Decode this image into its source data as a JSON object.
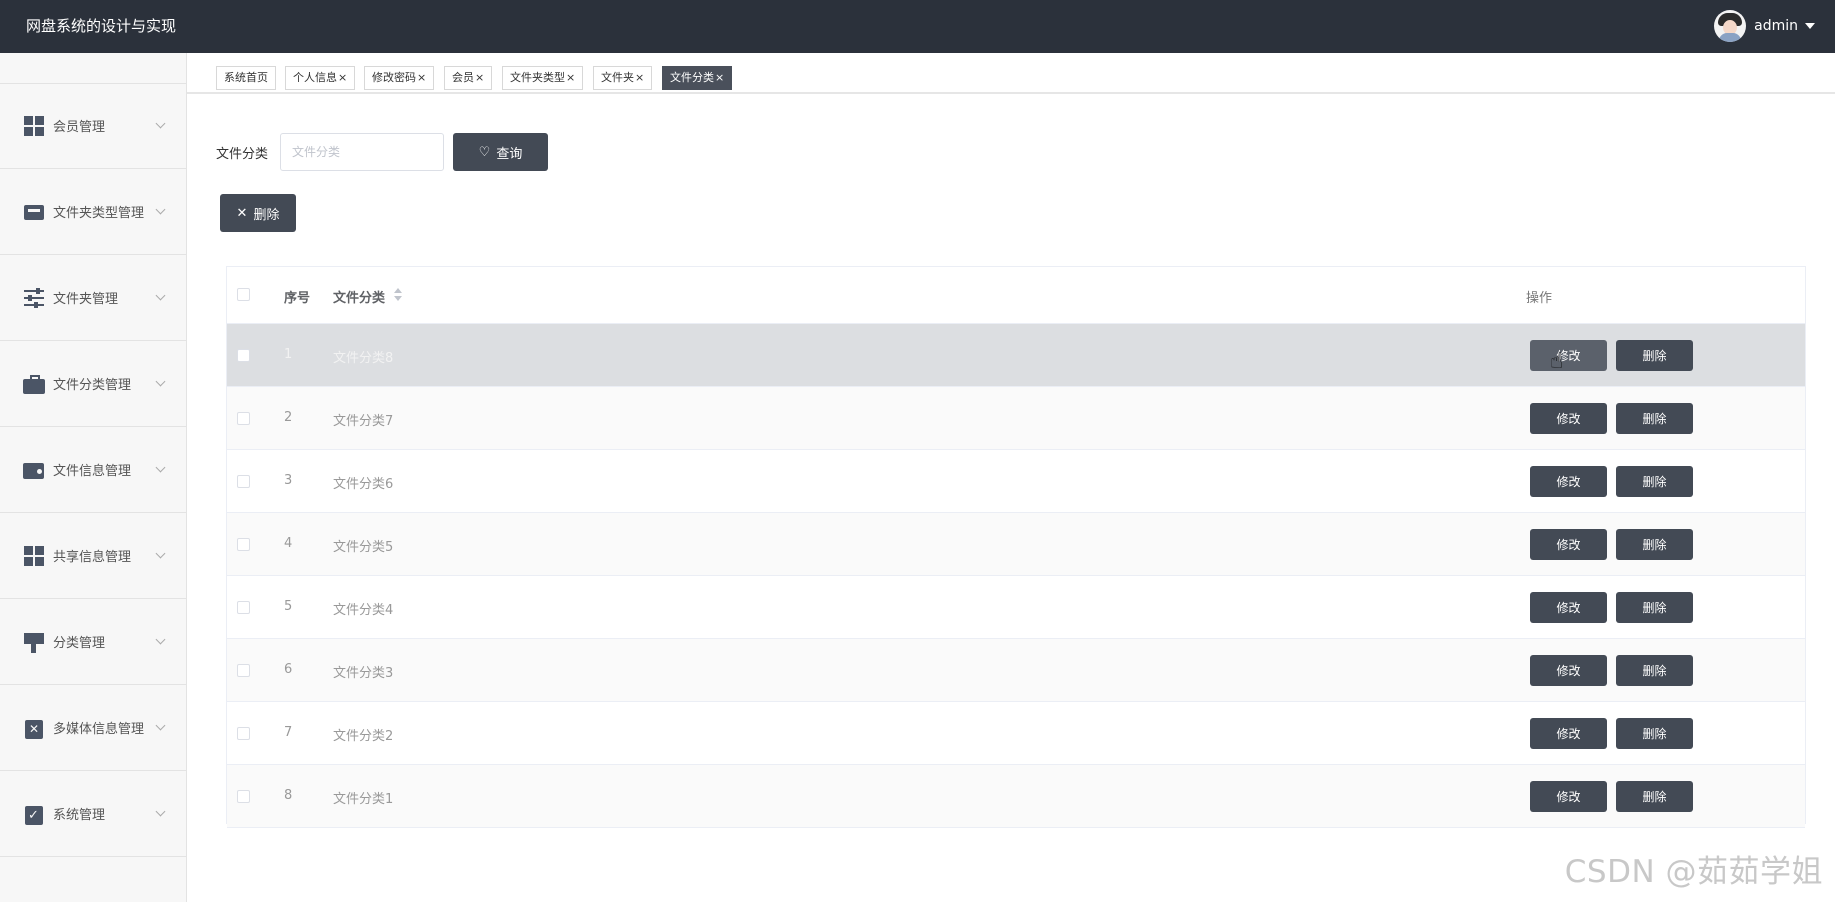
{
  "header": {
    "app_title": "网盘系统的设计与实现",
    "username": "admin"
  },
  "sidebar": {
    "items": [
      {
        "label": "会员管理",
        "icon": "grid-icon"
      },
      {
        "label": "文件夹类型管理",
        "icon": "inbox-icon"
      },
      {
        "label": "文件夹管理",
        "icon": "sliders-icon"
      },
      {
        "label": "文件分类管理",
        "icon": "briefcase-icon"
      },
      {
        "label": "文件信息管理",
        "icon": "wallet-icon"
      },
      {
        "label": "共享信息管理",
        "icon": "grid-icon"
      },
      {
        "label": "分类管理",
        "icon": "paint-brush-icon"
      },
      {
        "label": "多媒体信息管理",
        "icon": "clipboard-x-icon"
      },
      {
        "label": "系统管理",
        "icon": "clipboard-check-icon"
      }
    ]
  },
  "tabs": [
    {
      "label": "系统首页",
      "closable": false,
      "active": false
    },
    {
      "label": "个人信息",
      "closable": true,
      "active": false
    },
    {
      "label": "修改密码",
      "closable": true,
      "active": false
    },
    {
      "label": "会员",
      "closable": true,
      "active": false
    },
    {
      "label": "文件夹类型",
      "closable": true,
      "active": false
    },
    {
      "label": "文件夹",
      "closable": true,
      "active": false
    },
    {
      "label": "文件分类",
      "closable": true,
      "active": true
    }
  ],
  "tab_close_glyph": "×",
  "search": {
    "label": "文件分类",
    "placeholder": "文件分类",
    "value": "",
    "button_label": "查询"
  },
  "toolbar": {
    "delete_label": "删除"
  },
  "table": {
    "columns": {
      "index": "序号",
      "category": "文件分类",
      "actions": "操作"
    },
    "edit_label": "修改",
    "delete_label": "删除",
    "rows": [
      {
        "index": "1",
        "category": "文件分类8"
      },
      {
        "index": "2",
        "category": "文件分类7"
      },
      {
        "index": "3",
        "category": "文件分类6"
      },
      {
        "index": "4",
        "category": "文件分类5"
      },
      {
        "index": "5",
        "category": "文件分类4"
      },
      {
        "index": "6",
        "category": "文件分类3"
      },
      {
        "index": "7",
        "category": "文件分类2"
      },
      {
        "index": "8",
        "category": "文件分类1"
      }
    ]
  },
  "watermark": "CSDN @茹茹学姐",
  "colors": {
    "header_bg": "#2b313b",
    "button_bg": "#434a55",
    "active_tab_bg": "#4a505b",
    "hover_row_bg": "#dcdee1"
  }
}
